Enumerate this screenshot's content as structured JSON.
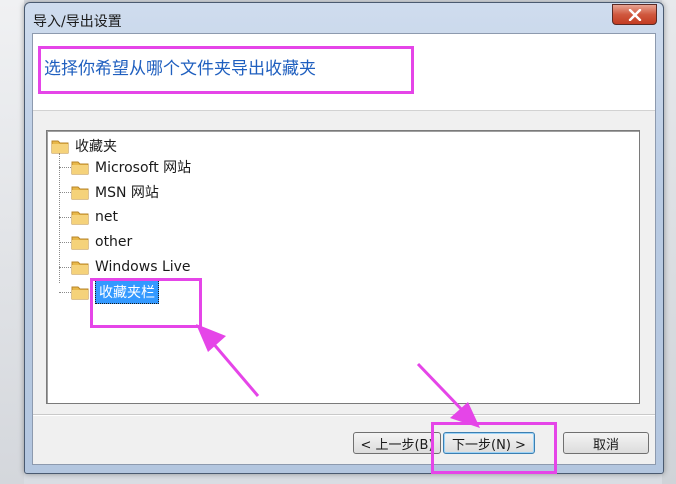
{
  "window": {
    "title": "导入/导出设置",
    "close_label": "x"
  },
  "header": {
    "prompt": "选择你希望从哪个文件夹导出收藏夹"
  },
  "tree": {
    "root": "收藏夹",
    "children": [
      {
        "label": "Microsoft 网站"
      },
      {
        "label": "MSN 网站"
      },
      {
        "label": "net"
      },
      {
        "label": "other"
      },
      {
        "label": "Windows Live"
      },
      {
        "label": "收藏夹栏",
        "selected": true
      }
    ]
  },
  "buttons": {
    "back": "< 上一步(B)",
    "next": "下一步(N) >",
    "cancel": "取消"
  },
  "colors": {
    "annotation": "#e545e8",
    "selection": "#3399ff",
    "prompt_text": "#1f5fbf",
    "folder": "#e8b84a"
  }
}
